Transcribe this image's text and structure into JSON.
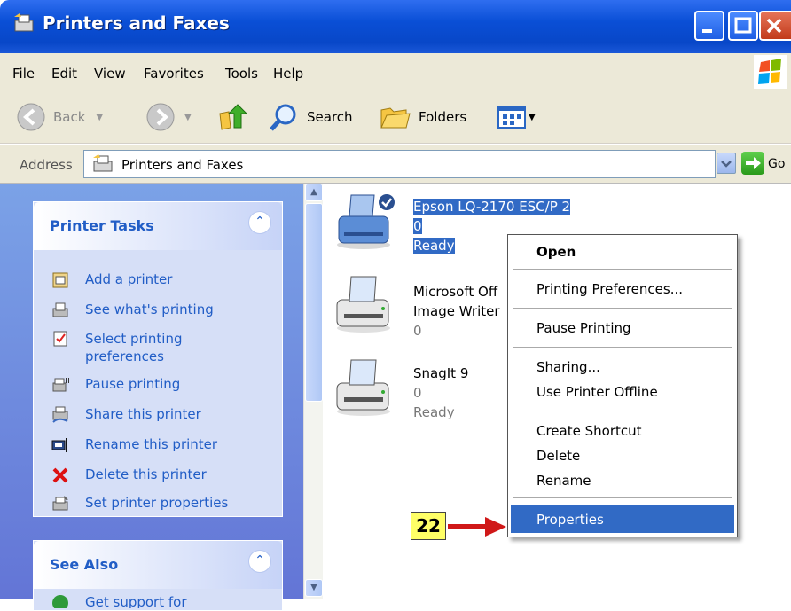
{
  "window": {
    "title": "Printers and Faxes"
  },
  "menu": [
    "File",
    "Edit",
    "View",
    "Favorites",
    "Tools",
    "Help"
  ],
  "toolbar": {
    "back": "Back",
    "search": "Search",
    "folders": "Folders"
  },
  "address": {
    "label": "Address",
    "value": "Printers and Faxes",
    "go": "Go"
  },
  "printer_tasks": {
    "title": "Printer Tasks",
    "items": [
      {
        "label": "Add a printer",
        "icon": "add-printer-icon"
      },
      {
        "label": "See what's printing",
        "icon": "see-printing-icon"
      },
      {
        "label": "Select printing preferences",
        "icon": "preferences-icon"
      },
      {
        "label": "Pause printing",
        "icon": "pause-printing-icon"
      },
      {
        "label": "Share this printer",
        "icon": "share-printer-icon"
      },
      {
        "label": "Rename this printer",
        "icon": "rename-printer-icon"
      },
      {
        "label": "Delete this printer",
        "icon": "delete-icon"
      },
      {
        "label": "Set printer properties",
        "icon": "printer-properties-icon"
      }
    ]
  },
  "see_also": {
    "title": "See Also",
    "first_item": "Get support for troubleshooting"
  },
  "printers": [
    {
      "name": "Epson LQ-2170 ESC/P 2",
      "docs": "0",
      "status": "Ready",
      "selected": true,
      "default": true
    },
    {
      "name": "Microsoft Office Document Image Writer",
      "line1": "Microsoft Off",
      "line2": "Image Writer",
      "docs": "0",
      "status": ""
    },
    {
      "name": "SnagIt 9",
      "docs": "0",
      "status": "Ready"
    }
  ],
  "context_menu": {
    "items": [
      "Open",
      "Printing Preferences...",
      "Pause Printing",
      "Sharing...",
      "Use Printer Offline",
      "Create Shortcut",
      "Delete",
      "Rename",
      "Properties"
    ],
    "highlighted": "Properties"
  },
  "annotation": {
    "step": "22"
  },
  "colors": {
    "selection": "#316ac5",
    "task_link": "#215dc6",
    "title_blue": "#0a4fd6"
  }
}
